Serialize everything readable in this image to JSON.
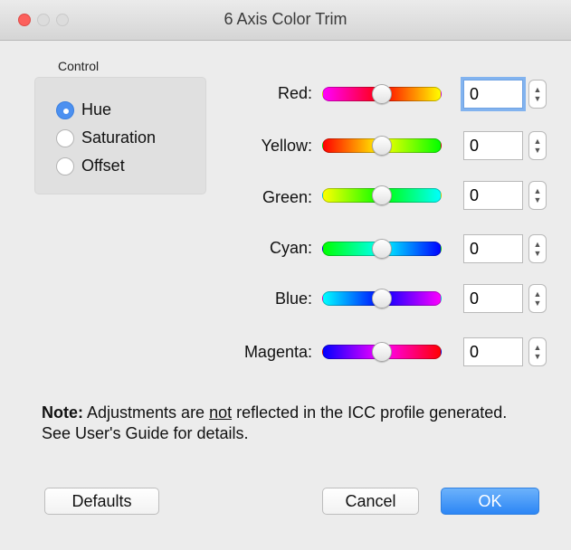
{
  "window": {
    "title": "6 Axis Color Trim"
  },
  "control": {
    "label": "Control",
    "options": [
      {
        "label": "Hue",
        "selected": true
      },
      {
        "label": "Saturation",
        "selected": false
      },
      {
        "label": "Offset",
        "selected": false
      }
    ]
  },
  "rows": [
    {
      "label": "Red:",
      "value": "0",
      "slider_level": 0.5,
      "gradient": [
        "#ff00ff",
        "#ff0000",
        "#ffff00"
      ]
    },
    {
      "label": "Yellow:",
      "value": "0",
      "slider_level": 0.5,
      "gradient": [
        "#ff0000",
        "#ffff00",
        "#00ff00"
      ]
    },
    {
      "label": "Green:",
      "value": "0",
      "slider_level": 0.5,
      "gradient": [
        "#ffff00",
        "#00ff00",
        "#00ffff"
      ]
    },
    {
      "label": "Cyan:",
      "value": "0",
      "slider_level": 0.5,
      "gradient": [
        "#00ff00",
        "#00ffff",
        "#0000ff"
      ]
    },
    {
      "label": "Blue:",
      "value": "0",
      "slider_level": 0.5,
      "gradient": [
        "#00ffff",
        "#0000ff",
        "#ff00ff"
      ]
    },
    {
      "label": "Magenta:",
      "value": "0",
      "slider_level": 0.5,
      "gradient": [
        "#0000ff",
        "#ff00ff",
        "#ff0000"
      ]
    }
  ],
  "note": {
    "bold": "Note:",
    "before": " Adjustments are ",
    "underlined": "not",
    "after": " reflected in the ICC profile generated. See User's Guide for details."
  },
  "buttons": {
    "defaults": "Defaults",
    "cancel": "Cancel",
    "ok": "OK"
  }
}
